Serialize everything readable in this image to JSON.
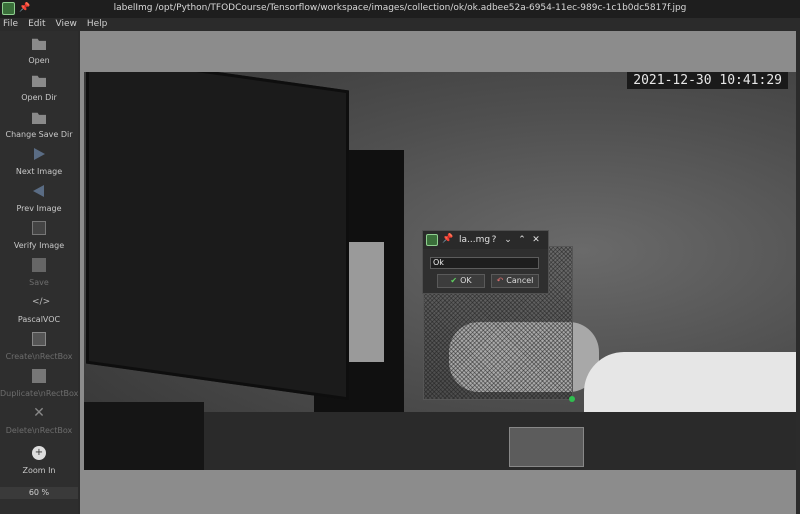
{
  "window": {
    "title": "labelImg /opt/Python/TFODCourse/Tensorflow/workspace/images/collection/ok/ok.adbee52a-6954-11ec-989c-1c1b0dc5817f.jpg"
  },
  "menu": [
    {
      "label": "File"
    },
    {
      "label": "Edit"
    },
    {
      "label": "View"
    },
    {
      "label": "Help"
    }
  ],
  "toolbar": {
    "open": "Open",
    "open_dir": "Open Dir",
    "change_save_dir": "Change Save Dir",
    "next_image": "Next Image",
    "prev_image": "Prev Image",
    "verify_image": "Verify Image",
    "save": "Save",
    "format": "PascalVOC",
    "create_rect": "Create\\nRectBox",
    "duplicate_rect": "Duplicate\\nRectBox",
    "delete_rect": "Delete\\nRectBox",
    "zoom_in": "Zoom In",
    "zoom_level": "60 %"
  },
  "image": {
    "timestamp": "2021-12-30  10:41:29"
  },
  "dialog": {
    "title": "la...mg",
    "help_btn": "?",
    "min_btn": "⌄",
    "max_btn": "⌃",
    "close_btn": "✕",
    "input_value": "Ok",
    "ok_label": "OK",
    "cancel_label": "Cancel"
  }
}
